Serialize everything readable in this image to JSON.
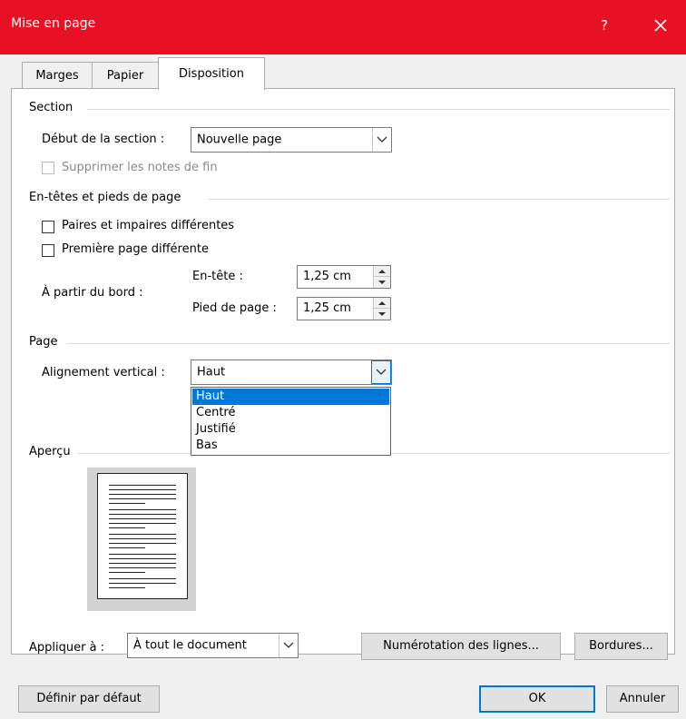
{
  "window": {
    "title": "Mise en page",
    "help": "?"
  },
  "tabs": [
    {
      "label": "Marges"
    },
    {
      "label": "Papier"
    },
    {
      "label": "Disposition"
    }
  ],
  "section": {
    "heading": "Section",
    "start_label": "Début de la section :",
    "start_value": "Nouvelle page",
    "suppress_endnotes": "Supprimer les notes de fin"
  },
  "headers": {
    "heading": "En-têtes et pieds de page",
    "odd_even": "Paires et impaires différentes",
    "first_page": "Première page différente",
    "from_edge": "À partir du bord :",
    "header_label": "En-tête :",
    "header_value": "1,25 cm",
    "footer_label": "Pied de page :",
    "footer_value": "1,25 cm"
  },
  "page": {
    "heading": "Page",
    "vertical_label": "Alignement vertical :",
    "vertical_value": "Haut",
    "options": [
      "Haut",
      "Centré",
      "Justifié",
      "Bas"
    ]
  },
  "preview": {
    "heading": "Aperçu"
  },
  "apply": {
    "label": "Appliquer à :",
    "value": "À tout le document"
  },
  "buttons": {
    "line_numbers": "Numérotation des lignes...",
    "borders": "Bordures...",
    "set_default": "Définir par défaut",
    "ok": "OK",
    "cancel": "Annuler"
  },
  "colors": {
    "titlebar": "#e81123",
    "selection": "#0078d7"
  }
}
